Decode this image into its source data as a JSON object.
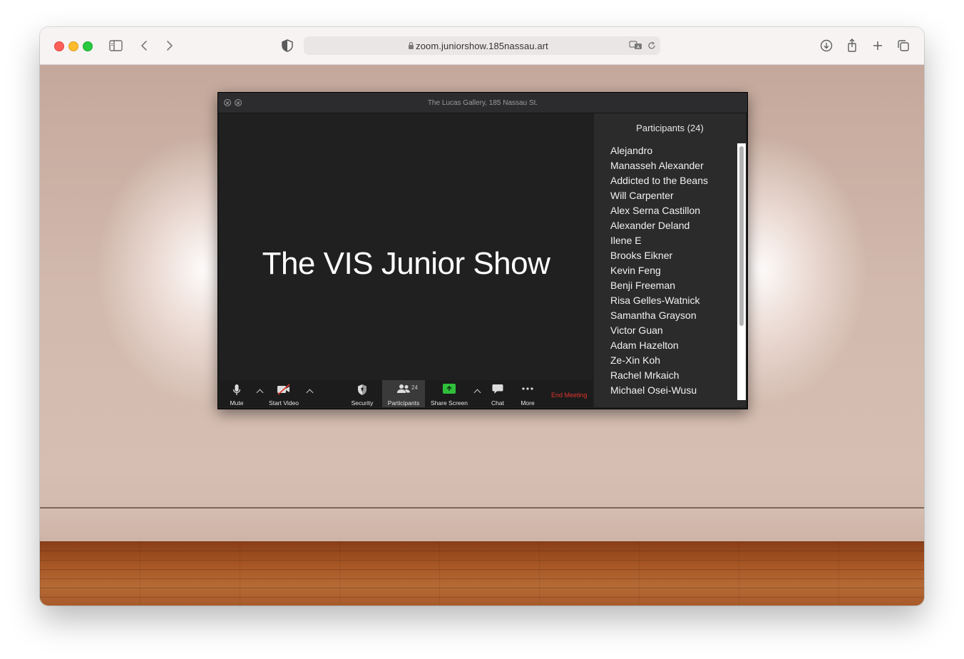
{
  "browser": {
    "url": "zoom.juniorshow.185nassau.art"
  },
  "zoom": {
    "window_title": "The Lucas Gallery, 185 Nassau St.",
    "stage_title": "The VIS Junior Show",
    "controls": {
      "mute": "Mute",
      "start_video": "Start Video",
      "security": "Security",
      "participants": "Participants",
      "participants_count": "24",
      "share_screen": "Share Screen",
      "chat": "Chat",
      "more": "More",
      "end_meeting": "End Meeting"
    },
    "colors": {
      "share_green": "#2fbf3a",
      "end_red": "#e0342c"
    }
  },
  "participants_panel": {
    "title": "Participants (24)",
    "names": [
      "Alejandro",
      "Manasseh Alexander",
      "Addicted to the Beans",
      "Will Carpenter",
      "Alex Serna Castillon",
      "Alexander Deland",
      "Ilene E",
      "Brooks Eikner",
      "Kevin Feng",
      "Benji Freeman",
      "Risa Gelles-Watnick",
      "Samantha Grayson",
      "Victor Guan",
      "Adam Hazelton",
      "Ze-Xin Koh",
      "Rachel Mrkaich",
      "Michael Osei-Wusu"
    ]
  }
}
